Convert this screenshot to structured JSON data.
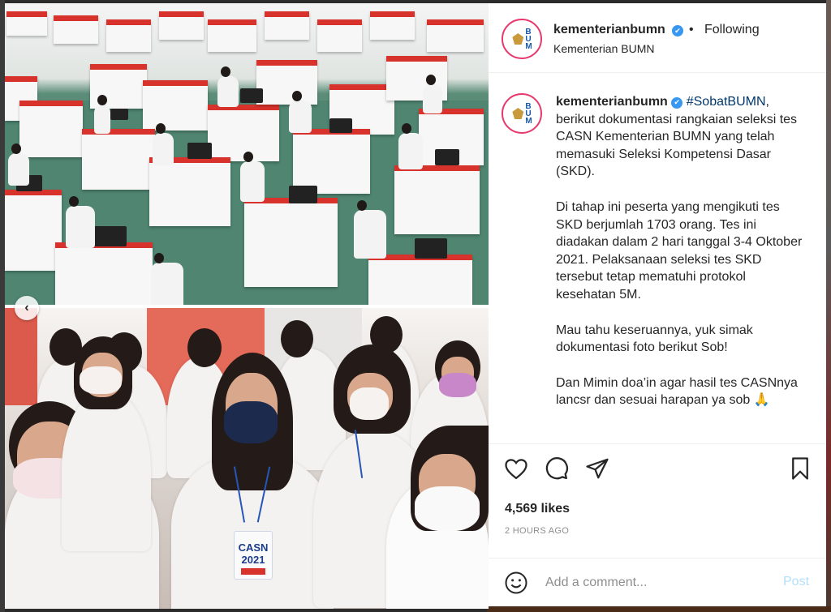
{
  "header": {
    "username": "kementerianbumn",
    "verified_icon": "verified-badge-icon",
    "separator": "•",
    "follow_status": "Following",
    "subtitle": "Kementerian BUMN"
  },
  "caption": {
    "username": "kementerianbumn",
    "hashtag": "#SobatBUMN",
    "line1_rest": ", berikut dokumentasi rangkaian seleksi tes CASN Kementerian BUMN yang telah memasuki Seleksi Kompetensi Dasar (SKD).",
    "paragraph2": "Di tahap ini peserta yang mengikuti tes SKD berjumlah 1703 orang. Tes ini diadakan dalam 2 hari tanggal 3-4 Oktober 2021. Pelaksanaan seleksi tes SKD tersebut tetap mematuhi protokol kesehatan 5M.",
    "paragraph3": "Mau tahu keseruannya, yuk simak dokumentasi foto berikut Sob!",
    "paragraph4": "Dan Mimin doa’in agar hasil tes CASNnya lancsr dan sesuai harapan ya sob 🙏"
  },
  "actions": {
    "like_icon": "heart-icon",
    "comment_icon": "comment-icon",
    "share_icon": "paper-plane-icon",
    "save_icon": "bookmark-icon"
  },
  "likes": "4,569 likes",
  "time_ago": "2 HOURS AGO",
  "comment": {
    "emoji_icon": "smiley-icon",
    "placeholder": "Add a comment...",
    "post_label": "Post"
  },
  "photo": {
    "id_card_line1": "CASN",
    "id_card_line2": "2021"
  },
  "carousel": {
    "prev_glyph": "‹"
  },
  "colors": {
    "accent_blue": "#0095f6",
    "post_disabled": "#b2dffc",
    "verified": "#3897f0",
    "text": "#262626",
    "muted": "#8e8e8e"
  }
}
